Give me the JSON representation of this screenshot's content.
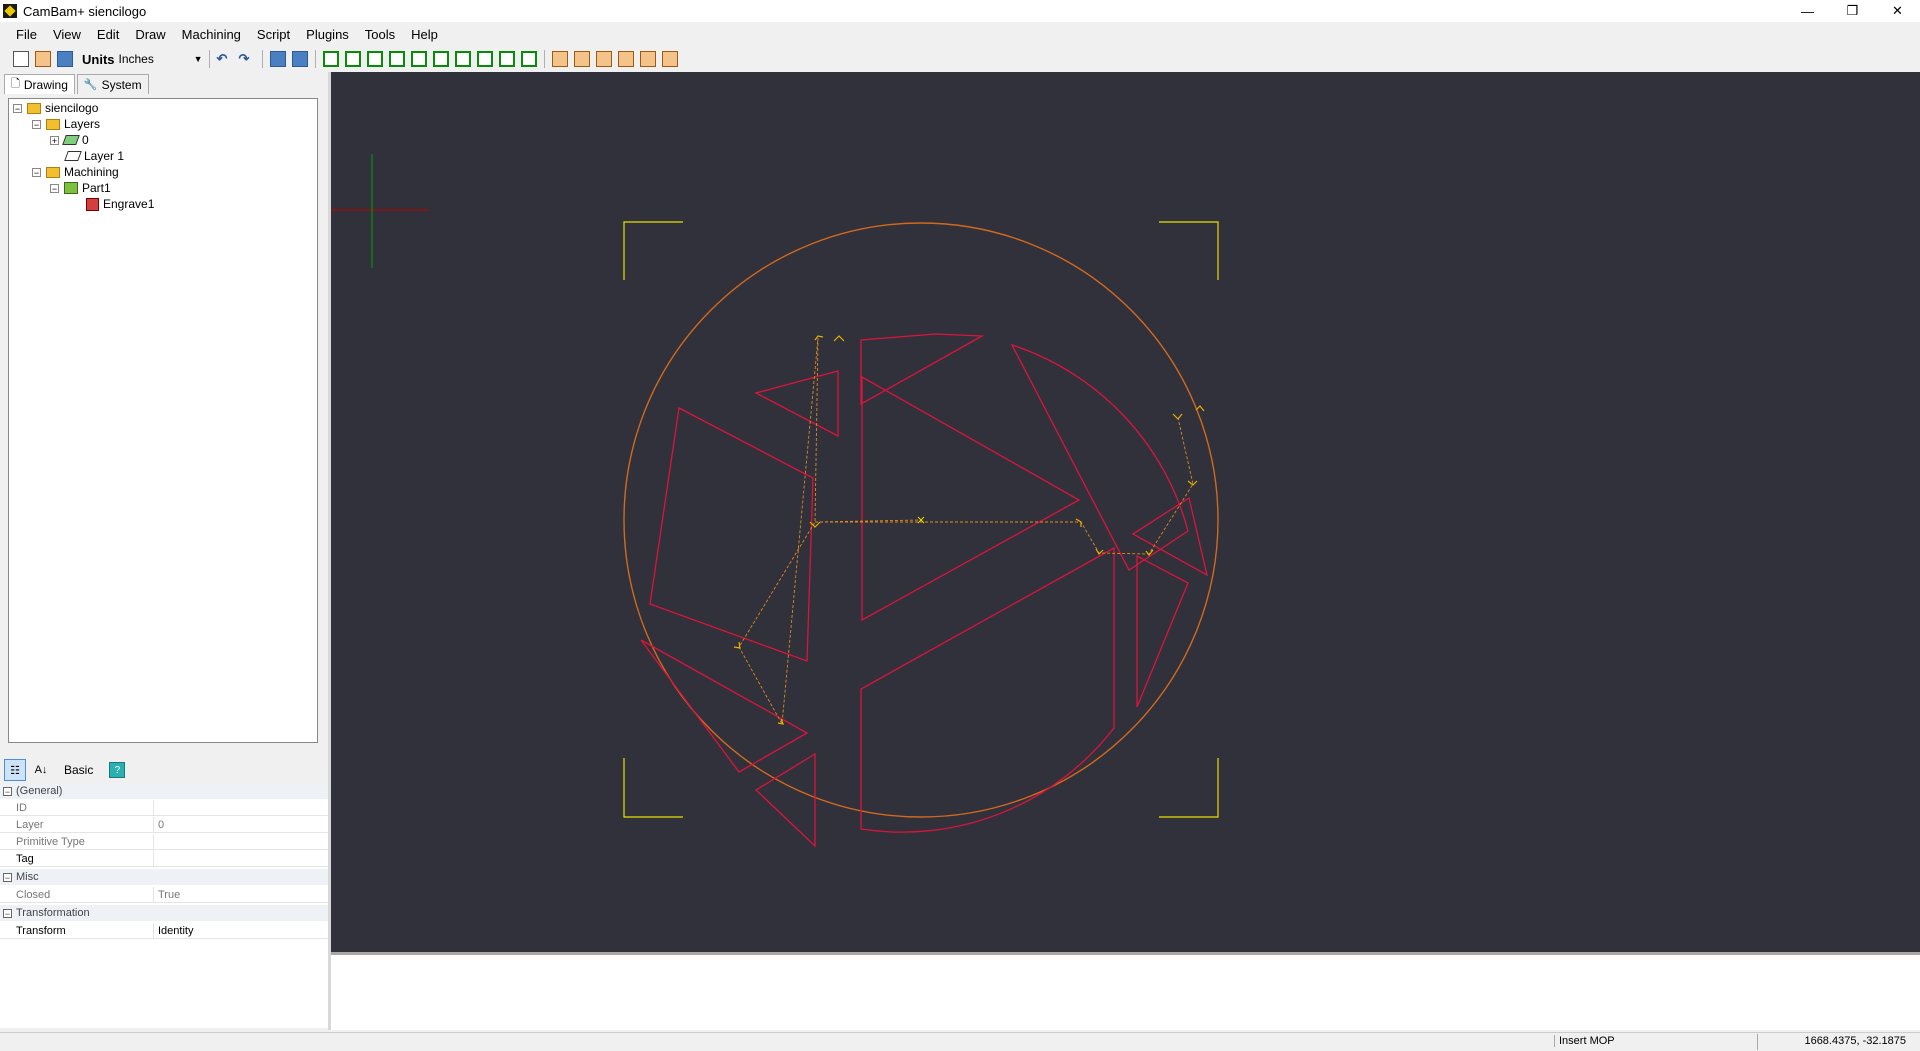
{
  "window": {
    "title": "CamBam+  siencilogo",
    "app_icon": "cambam-app-icon"
  },
  "window_controls": {
    "minimize": "—",
    "restore": "❒",
    "close": "✕"
  },
  "menu": [
    "File",
    "View",
    "Edit",
    "Draw",
    "Machining",
    "Script",
    "Plugins",
    "Tools",
    "Help"
  ],
  "toolbar": {
    "units_label": "Units",
    "units_value": "Inches"
  },
  "left_tabs": [
    {
      "label": "Drawing",
      "icon": "page-icon"
    },
    {
      "label": "System",
      "icon": "wrench-icon"
    }
  ],
  "tree": {
    "root": "siencilogo",
    "layers": "Layers",
    "layer_0": "0",
    "layer_1": "Layer 1",
    "machining": "Machining",
    "part": "Part1",
    "mop": "Engrave1"
  },
  "properties": {
    "mode_label": "Basic",
    "categories": {
      "general": "(General)",
      "misc": "Misc",
      "transformation": "Transformation"
    },
    "rows": {
      "id": {
        "name": "ID",
        "value": ""
      },
      "layer": {
        "name": "Layer",
        "value": "0"
      },
      "primitive_type": {
        "name": "Primitive Type",
        "value": ""
      },
      "tag": {
        "name": "Tag",
        "value": ""
      },
      "closed": {
        "name": "Closed",
        "value": "True"
      },
      "transform": {
        "name": "Transform",
        "value": "Identity"
      }
    }
  },
  "status": {
    "mode": "Insert MOP",
    "coords": "1668.4375, -32.1875"
  },
  "colors": {
    "canvas_bg": "#30313a",
    "circle": "#d2691e",
    "shape": "#dc143c",
    "toolpath": "#e08a20",
    "selection": "#e8e000",
    "axis_x": "#c00000",
    "axis_y": "#00a000"
  }
}
